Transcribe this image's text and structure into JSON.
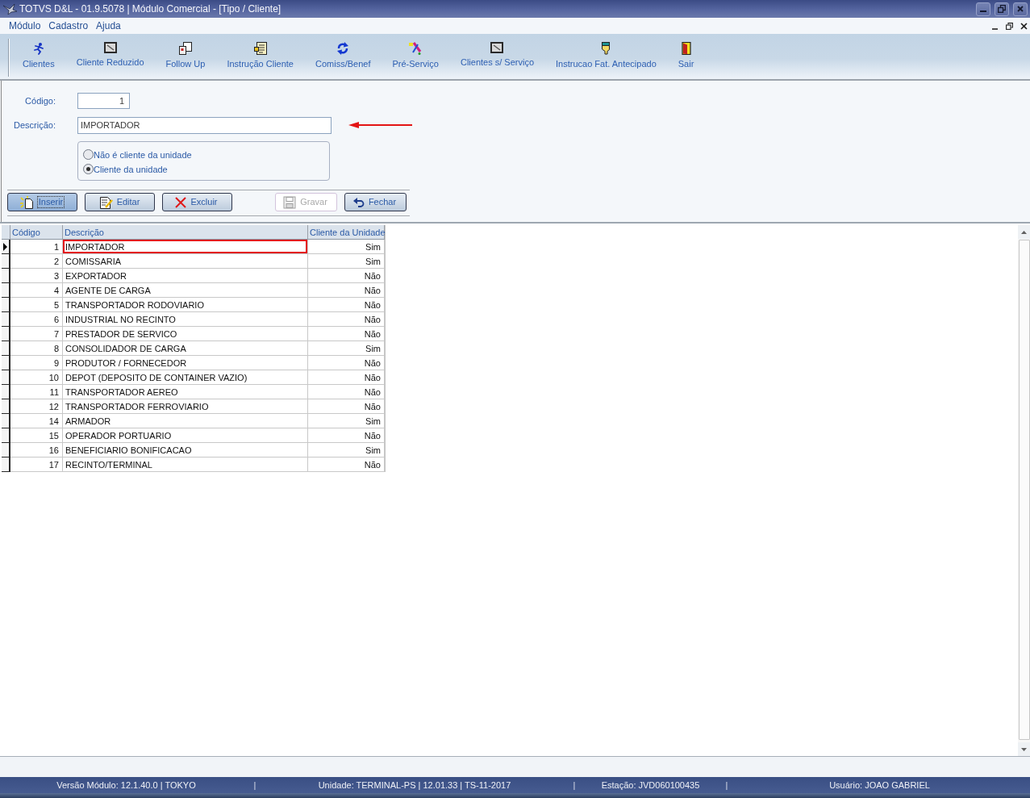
{
  "window": {
    "title": "TOTVS D&L - 01.9.5078 | Módulo Comercial - [Tipo / Cliente]"
  },
  "menu": [
    "Módulo",
    "Cadastro",
    "Ajuda"
  ],
  "toolbar": [
    "Clientes",
    "Cliente Reduzido",
    "Follow Up",
    "Instrução Cliente",
    "Comiss/Benef",
    "Pré-Serviço",
    "Clientes s/ Serviço",
    "Instrucao Fat. Antecipado",
    "Sair"
  ],
  "form": {
    "fields": [
      {
        "kind": "number",
        "label": "Código:",
        "value": "1"
      },
      {
        "kind": "text",
        "label": "Descrição:",
        "value": "IMPORTADOR"
      }
    ],
    "options": [
      {
        "label": "Não é cliente da unidade",
        "selected": false
      },
      {
        "label": "Cliente da unidade",
        "selected": true
      }
    ],
    "button_groups": [
      {
        "buttons": [
          {
            "label": "Inserir",
            "focused": true,
            "disabled": false
          },
          {
            "label": "Editar",
            "focused": false,
            "disabled": false
          },
          {
            "label": "Excluir",
            "focused": false,
            "disabled": false
          }
        ]
      },
      {
        "buttons": [
          {
            "label": "Gravar",
            "focused": false,
            "disabled": true
          },
          {
            "label": "Fechar",
            "focused": false,
            "disabled": false
          }
        ]
      }
    ]
  },
  "table": {
    "columns": [
      "Código",
      "Descrição",
      "Cliente da Unidade"
    ],
    "rows": [
      {
        "cells": [
          "1",
          "IMPORTADOR",
          "Sim"
        ],
        "selected": true,
        "highlighted": true
      },
      {
        "cells": [
          "2",
          "COMISSARIA",
          "Sim"
        ],
        "selected": false,
        "highlighted": false
      },
      {
        "cells": [
          "3",
          "EXPORTADOR",
          "Não"
        ],
        "selected": false,
        "highlighted": false
      },
      {
        "cells": [
          "4",
          "AGENTE DE CARGA",
          "Não"
        ],
        "selected": false,
        "highlighted": false
      },
      {
        "cells": [
          "5",
          "TRANSPORTADOR RODOVIARIO",
          "Não"
        ],
        "selected": false,
        "highlighted": false
      },
      {
        "cells": [
          "6",
          "INDUSTRIAL NO RECINTO",
          "Não"
        ],
        "selected": false,
        "highlighted": false
      },
      {
        "cells": [
          "7",
          "PRESTADOR DE SERVICO",
          "Não"
        ],
        "selected": false,
        "highlighted": false
      },
      {
        "cells": [
          "8",
          "CONSOLIDADOR DE CARGA",
          "Sim"
        ],
        "selected": false,
        "highlighted": false
      },
      {
        "cells": [
          "9",
          "PRODUTOR / FORNECEDOR",
          "Não"
        ],
        "selected": false,
        "highlighted": false
      },
      {
        "cells": [
          "10",
          "DEPOT (DEPOSITO DE CONTAINER VAZIO)",
          "Não"
        ],
        "selected": false,
        "highlighted": false
      },
      {
        "cells": [
          "11",
          "TRANSPORTADOR AEREO",
          "Não"
        ],
        "selected": false,
        "highlighted": false
      },
      {
        "cells": [
          "12",
          "TRANSPORTADOR FERROVIARIO",
          "Não"
        ],
        "selected": false,
        "highlighted": false
      },
      {
        "cells": [
          "14",
          "ARMADOR",
          "Sim"
        ],
        "selected": false,
        "highlighted": false
      },
      {
        "cells": [
          "15",
          "OPERADOR PORTUARIO",
          "Não"
        ],
        "selected": false,
        "highlighted": false
      },
      {
        "cells": [
          "16",
          "BENEFICIARIO BONIFICACAO",
          "Sim"
        ],
        "selected": false,
        "highlighted": false
      },
      {
        "cells": [
          "17",
          "RECINTO/TERMINAL",
          "Não"
        ],
        "selected": false,
        "highlighted": false
      }
    ]
  },
  "status_bar": [
    {
      "kind": "panel",
      "text": "Versão Módulo: 12.1.40.0 | TOKYO"
    },
    {
      "kind": "separator",
      "text": "|"
    },
    {
      "kind": "panel",
      "text": "Unidade: TERMINAL-PS | 12.01.33 | TS-11-2017"
    },
    {
      "kind": "separator",
      "text": "|"
    },
    {
      "kind": "panel",
      "text": "Estação: JVD060100435"
    },
    {
      "kind": "separator",
      "text": "|"
    },
    {
      "kind": "panel",
      "text": "Usuário: JOAO GABRIEL"
    }
  ]
}
